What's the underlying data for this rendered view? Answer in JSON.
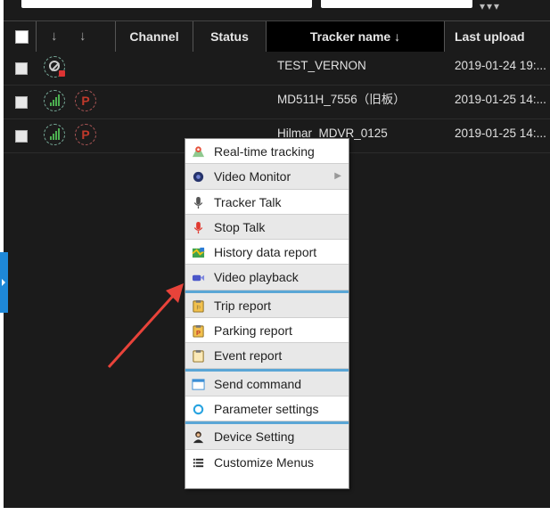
{
  "table": {
    "headers": {
      "channel": "Channel",
      "status": "Status",
      "tracker_name": "Tracker name ↓",
      "last_upload": "Last upload"
    },
    "rows": [
      {
        "name": "TEST_VERNON",
        "last_upload": "2019-01-24 19:..."
      },
      {
        "name": "MD511H_7556（旧板）",
        "last_upload": "2019-01-25 14:..."
      },
      {
        "name": "Hilmar_MDVR_0125",
        "last_upload": "2019-01-25 14:..."
      }
    ]
  },
  "context_menu": {
    "items": [
      {
        "label": "Real-time tracking",
        "icon": "map-pin-icon"
      },
      {
        "label": "Video Monitor",
        "icon": "camera-icon"
      },
      {
        "label": "Tracker Talk",
        "icon": "microphone-icon"
      },
      {
        "label": "Stop Talk",
        "icon": "microphone-red-icon"
      },
      {
        "label": "History data report",
        "icon": "map-report-icon"
      },
      {
        "label": "Video playback",
        "icon": "video-camera-icon"
      },
      {
        "label": "Trip report",
        "icon": "clipboard-trip-icon"
      },
      {
        "label": "Parking report",
        "icon": "clipboard-parking-icon"
      },
      {
        "label": "Event report",
        "icon": "clipboard-event-icon"
      },
      {
        "label": "Send command",
        "icon": "window-icon"
      },
      {
        "label": "Parameter settings",
        "icon": "ring-icon"
      },
      {
        "label": "Device Setting",
        "icon": "user-icon"
      },
      {
        "label": "Customize Menus",
        "icon": "list-icon"
      }
    ]
  },
  "colors": {
    "background": "#1b1b1b",
    "separator": "#5aa6d6",
    "arrow": "#e8433a"
  }
}
